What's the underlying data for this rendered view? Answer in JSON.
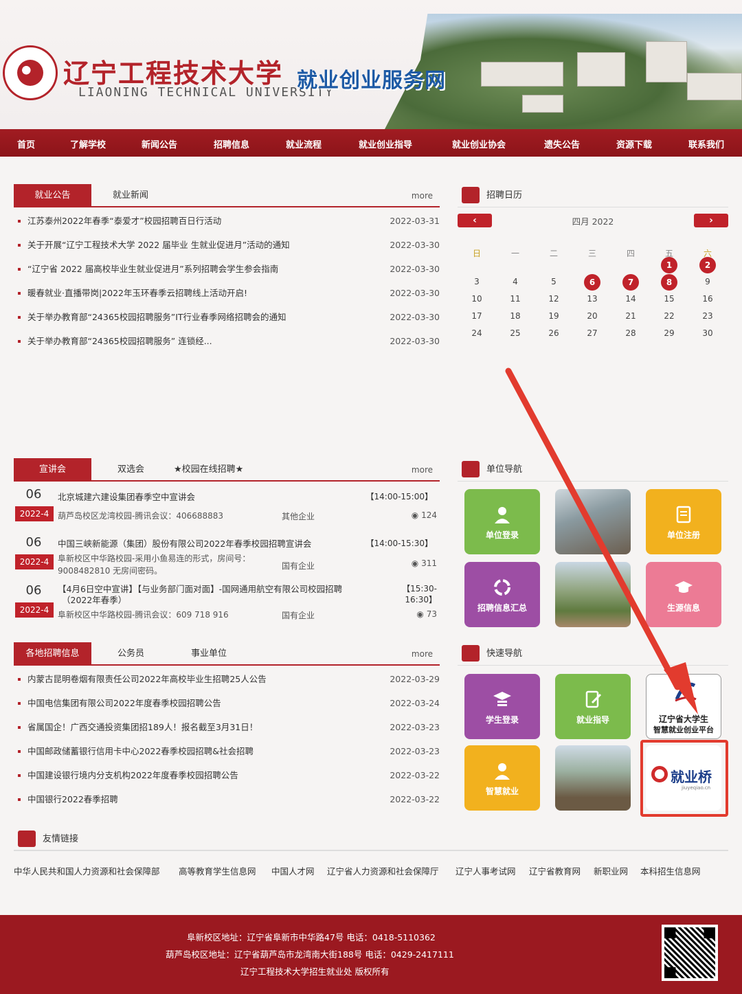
{
  "header": {
    "school_name": "辽宁工程技术大学",
    "school_name_en": "LIAONING TECHNICAL UNIVERSITY",
    "site_title": "就业创业服务网"
  },
  "nav": [
    "首页",
    "了解学校",
    "新闻公告",
    "招聘信息",
    "就业流程",
    "就业创业指导",
    "就业创业协会",
    "遗失公告",
    "资源下载",
    "联系我们"
  ],
  "notice_panel": {
    "tabs": [
      "就业公告",
      "就业新闻"
    ],
    "more": "more",
    "items": [
      {
        "title": "江苏泰州2022年春季“泰爱才”校园招聘百日行活动",
        "date": "2022-03-31"
      },
      {
        "title": "关于开展“辽宁工程技术大学 2022 届毕业 生就业促进月”活动的通知",
        "date": "2022-03-30"
      },
      {
        "title": "“辽宁省 2022 届高校毕业生就业促进月”系列招聘会学生参会指南",
        "date": "2022-03-30"
      },
      {
        "title": "暖春就业·直播带岗|2022年玉环春季云招聘线上活动开启!",
        "date": "2022-03-30"
      },
      {
        "title": "关于举办教育部“24365校园招聘服务”IT行业春季网络招聘会的通知",
        "date": "2022-03-30"
      },
      {
        "title": "关于举办教育部“24365校园招聘服务” 连锁经...",
        "date": "2022-03-30"
      }
    ]
  },
  "calendar": {
    "title": "招聘日历",
    "month": "四月 2022",
    "prev": "‹",
    "next": "›",
    "weekdays": [
      "日",
      "一",
      "二",
      "三",
      "四",
      "五",
      "六"
    ],
    "rows": [
      [
        "",
        "",
        "",
        "",
        "",
        "1",
        "2"
      ],
      [
        "3",
        "4",
        "5",
        "6",
        "7",
        "8",
        "9"
      ],
      [
        "10",
        "11",
        "12",
        "13",
        "14",
        "15",
        "16"
      ],
      [
        "17",
        "18",
        "19",
        "20",
        "21",
        "22",
        "23"
      ],
      [
        "24",
        "25",
        "26",
        "27",
        "28",
        "29",
        "30"
      ]
    ],
    "highlighted": [
      "1",
      "2",
      "6",
      "7",
      "8"
    ]
  },
  "seminar_panel": {
    "tabs": [
      "宣讲会",
      "双选会",
      "★校园在线招聘★"
    ],
    "more": "more",
    "items": [
      {
        "day": "06",
        "month": "2022-4",
        "title": "北京城建六建设集团春季空中宣讲会",
        "time": "【14:00-15:00】",
        "sub": "葫芦岛校区龙湾校园-腾讯会议：406688883",
        "type": "其他企业",
        "views": "124"
      },
      {
        "day": "06",
        "month": "2022-4",
        "title": "中国三峡新能源（集团）股份有限公司2022年春季校园招聘宣讲会",
        "time": "【14:00-15:30】",
        "sub": "阜新校区中华路校园-采用小鱼易连的形式，房间号：",
        "sub2": "9008482810 无房间密码。",
        "type": "国有企业",
        "views": "311"
      },
      {
        "day": "06",
        "month": "2022-4",
        "title": "【4月6日空中宣讲】【与业务部门面对面】-国网通用航空有限公司校园招聘",
        "title2": "（2022年春季）",
        "time": "【15:30-",
        "time2": "16:30】",
        "sub": "阜新校区中华路校园-腾讯会议：609 718 916",
        "type": "国有企业",
        "views": "73"
      }
    ]
  },
  "unit_nav": {
    "title": "单位导航",
    "tiles": [
      "单位登录",
      "",
      "单位注册",
      "招聘信息汇总",
      "",
      "生源信息"
    ]
  },
  "recruit_panel": {
    "tabs": [
      "各地招聘信息",
      "公务员",
      "事业单位"
    ],
    "more": "more",
    "items": [
      {
        "title": "内蒙古昆明卷烟有限责任公司2022年高校毕业生招聘25人公告",
        "date": "2022-03-29"
      },
      {
        "title": "中国电信集团有限公司2022年度春季校园招聘公告",
        "date": "2022-03-24"
      },
      {
        "title": "省属国企！广西交通投资集团招189人！报名截至3月31日！",
        "date": "2022-03-23"
      },
      {
        "title": "中国邮政储蓄银行信用卡中心2022春季校园招聘&社会招聘",
        "date": "2022-03-23"
      },
      {
        "title": "中国建设银行境内分支机构2022年度春季校园招聘公告",
        "date": "2022-03-22"
      },
      {
        "title": "中国银行2022春季招聘",
        "date": "2022-03-22"
      }
    ]
  },
  "quick_nav": {
    "title": "快速导航",
    "tiles": [
      "学生登录",
      "就业指导",
      "辽宁省大学生",
      "智慧就业创业平台",
      "智慧就业",
      "",
      "就业桥",
      "jiuyeqiao.cn"
    ]
  },
  "friend_links": {
    "title": "友情链接",
    "items": [
      "中华人民共和国人力资源和社会保障部",
      "高等教育学生信息网",
      "中国人才网",
      "辽宁省人力资源和社会保障厅",
      "辽宁人事考试网",
      "辽宁省教育网",
      "新职业网",
      "本科招生信息网"
    ]
  },
  "footer": {
    "line1": "阜新校区地址：辽宁省阜新市中华路47号    电话：0418-5110362",
    "line2": "葫芦岛校区地址：辽宁省葫芦岛市龙湾南大街188号    电话：0429-2417111",
    "line3": "辽宁工程技术大学招生就业处 版权所有"
  },
  "colors": {
    "brand_red": "#b3232a",
    "nav_red": "#8c1419",
    "title_blue": "#1d5aa5"
  }
}
